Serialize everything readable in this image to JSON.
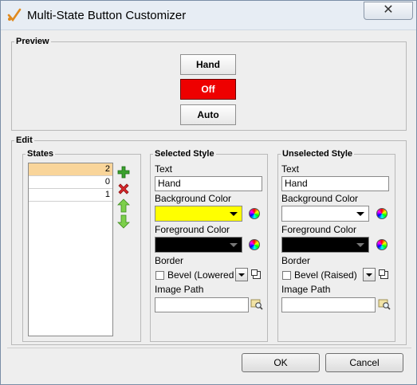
{
  "window": {
    "title": "Multi-State Button Customizer",
    "close_glyph": "✕"
  },
  "preview": {
    "legend": "Preview",
    "buttons": [
      {
        "label": "Hand",
        "active": false
      },
      {
        "label": "Off",
        "active": true
      },
      {
        "label": "Auto",
        "active": false
      }
    ],
    "active_color": "#ee0000"
  },
  "edit": {
    "legend": "Edit",
    "states": {
      "legend": "States",
      "rows": [
        "2",
        "0",
        "1"
      ],
      "selected_index": 0,
      "actions": [
        "add-icon",
        "delete-icon",
        "move-up-icon",
        "move-down-icon"
      ]
    },
    "selected_style": {
      "legend": "Selected Style",
      "text_label": "Text",
      "text_value": "Hand",
      "bg_label": "Background Color",
      "bg_color": "#ffff00",
      "fg_label": "Foreground Color",
      "fg_color": "#000000",
      "border_label": "Border",
      "border_value": "Bevel (Lowered",
      "image_label": "Image Path",
      "image_value": ""
    },
    "unselected_style": {
      "legend": "Unselected Style",
      "text_label": "Text",
      "text_value": "Hand",
      "bg_label": "Background Color",
      "bg_color": "#ffffff",
      "fg_label": "Foreground Color",
      "fg_color": "#000000",
      "border_label": "Border",
      "border_value": "Bevel (Raised)",
      "image_label": "Image Path",
      "image_value": ""
    }
  },
  "footer": {
    "ok_label": "OK",
    "cancel_label": "Cancel"
  }
}
